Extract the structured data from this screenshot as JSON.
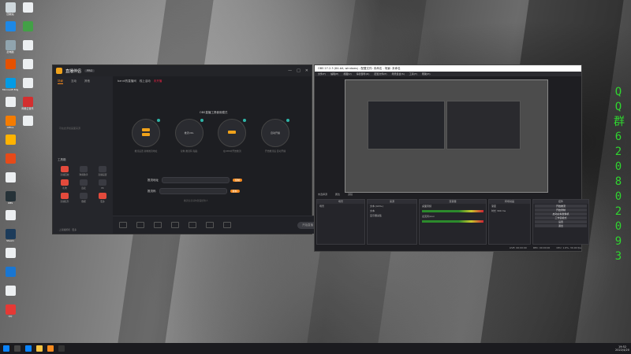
{
  "desktop": {
    "icons": [
      {
        "label": "回收站",
        "color": "#cfd8dc"
      },
      {
        "label": "",
        "color": "#1e88e5"
      },
      {
        "label": "此电脑",
        "color": "#90a4ae"
      },
      {
        "label": "",
        "color": "#e65100"
      },
      {
        "label": "Microsoft Edge",
        "color": "#039be5"
      },
      {
        "label": "",
        "color": "#eceff1"
      },
      {
        "label": "Office",
        "color": "#f57c00"
      },
      {
        "label": "",
        "color": "#ffb300"
      },
      {
        "label": "",
        "color": "#e64a19"
      },
      {
        "label": "",
        "color": "#eceff1"
      },
      {
        "label": "OBS",
        "color": "#263238"
      },
      {
        "label": "",
        "color": "#eceff1"
      },
      {
        "label": "Steam",
        "color": "#1c3b5a"
      },
      {
        "label": "",
        "color": "#eceff1"
      },
      {
        "label": "",
        "color": "#1976d2"
      },
      {
        "label": "",
        "color": "#eceff1"
      },
      {
        "label": "QQ",
        "color": "#e53935"
      },
      {
        "label": "",
        "color": "#eceff1"
      },
      {
        "label": "",
        "color": "#43a047"
      },
      {
        "label": "",
        "color": "#eceff1"
      },
      {
        "label": "",
        "color": "#eceff1"
      },
      {
        "label": "",
        "color": "#eceff1"
      },
      {
        "label": "网易云音乐",
        "color": "#d32f2f"
      },
      {
        "label": "",
        "color": "#eceff1"
      }
    ],
    "qq_vertical": [
      "Q",
      "Q",
      "群",
      "6",
      "2",
      "0",
      "8",
      "0",
      "2",
      "0",
      "9",
      "3"
    ]
  },
  "app": {
    "name": "直播伴侣",
    "badge": "PRO",
    "window_controls": [
      "—",
      "□",
      "✕"
    ],
    "sidebar_tabs": [
      "场景",
      "互动",
      "其他"
    ],
    "side_note": "可在此添加画面来源",
    "tools_title": "工具箱",
    "tools": [
      {
        "label": "直播回放",
        "hot": true
      },
      {
        "label": "弹幕助手",
        "hot": false
      },
      {
        "label": "直播设置",
        "hot": false
      },
      {
        "label": "礼物",
        "hot": true
      },
      {
        "label": "连麦",
        "hot": false
      },
      {
        "label": "PK",
        "hot": false
      },
      {
        "label": "直播任务",
        "hot": true
      },
      {
        "label": "数据",
        "hot": false
      },
      {
        "label": "更多",
        "hot": true
      }
    ],
    "side_footer": "· 上直播游戏 · 更多",
    "main_header": {
      "user": "bandi的直播间",
      "tag1": "线上活动",
      "tag2": "未开播",
      "status": "直播中"
    },
    "flow_title": "OBS直播工具使用模式",
    "flow_nodes": [
      {
        "pills": 2,
        "text": "",
        "caption": "推流设置 复制推流地址"
      },
      {
        "pills": 0,
        "text": "推流URL",
        "caption": "复制 推流码 粘贴"
      },
      {
        "pills": 1,
        "text": "",
        "caption": "在OBS中开始推流"
      },
      {
        "pills": 0,
        "text": "自动开播",
        "caption": "开始推流后 自动开播"
      }
    ],
    "rows": [
      {
        "label": "推流地址",
        "btn": "复制"
      },
      {
        "label": "推流码",
        "btn": "复制"
      }
    ],
    "hint": "推流信息请勿泄露给他人",
    "start_label": "开始直播"
  },
  "obs": {
    "title": "OBS 27.2.3 (64-bit, windows) - 配置文件: 未命名 - 场景: 未命名",
    "menu": [
      "文件(F)",
      "编辑(E)",
      "视图(V)",
      "停靠部件(D)",
      "配置文件(P)",
      "场景集合(S)",
      "工具(T)",
      "帮助(H)"
    ],
    "under_preview": [
      "未选择源",
      "属性",
      "滤镜"
    ],
    "docks": [
      {
        "title": "场景",
        "items": [
          "场景"
        ]
      },
      {
        "title": "来源",
        "items": [
          "文本 (GDI+)",
          "文本",
          "显示器采集"
        ]
      },
      {
        "title": "混音器",
        "items": [
          "桌面音频",
          "麦克风/Aux"
        ]
      },
      {
        "title": "转场动画",
        "items": [
          "渐变",
          "时长 300 ms"
        ]
      },
      {
        "title": "控件",
        "items": [
          "开始推流",
          "开始录制",
          "启动虚拟摄像机",
          "工作室模式",
          "设置",
          "退出"
        ]
      }
    ],
    "status": [
      "LIVE: 00:00:00",
      "REC: 00:00:00",
      "CPU: 1.6%, 30.00 fps"
    ]
  },
  "taskbar": {
    "time": "19:52",
    "date": "2022/4/20"
  },
  "colors": {
    "accent": "#f58a1f",
    "obs_green": "#2fd52f"
  }
}
